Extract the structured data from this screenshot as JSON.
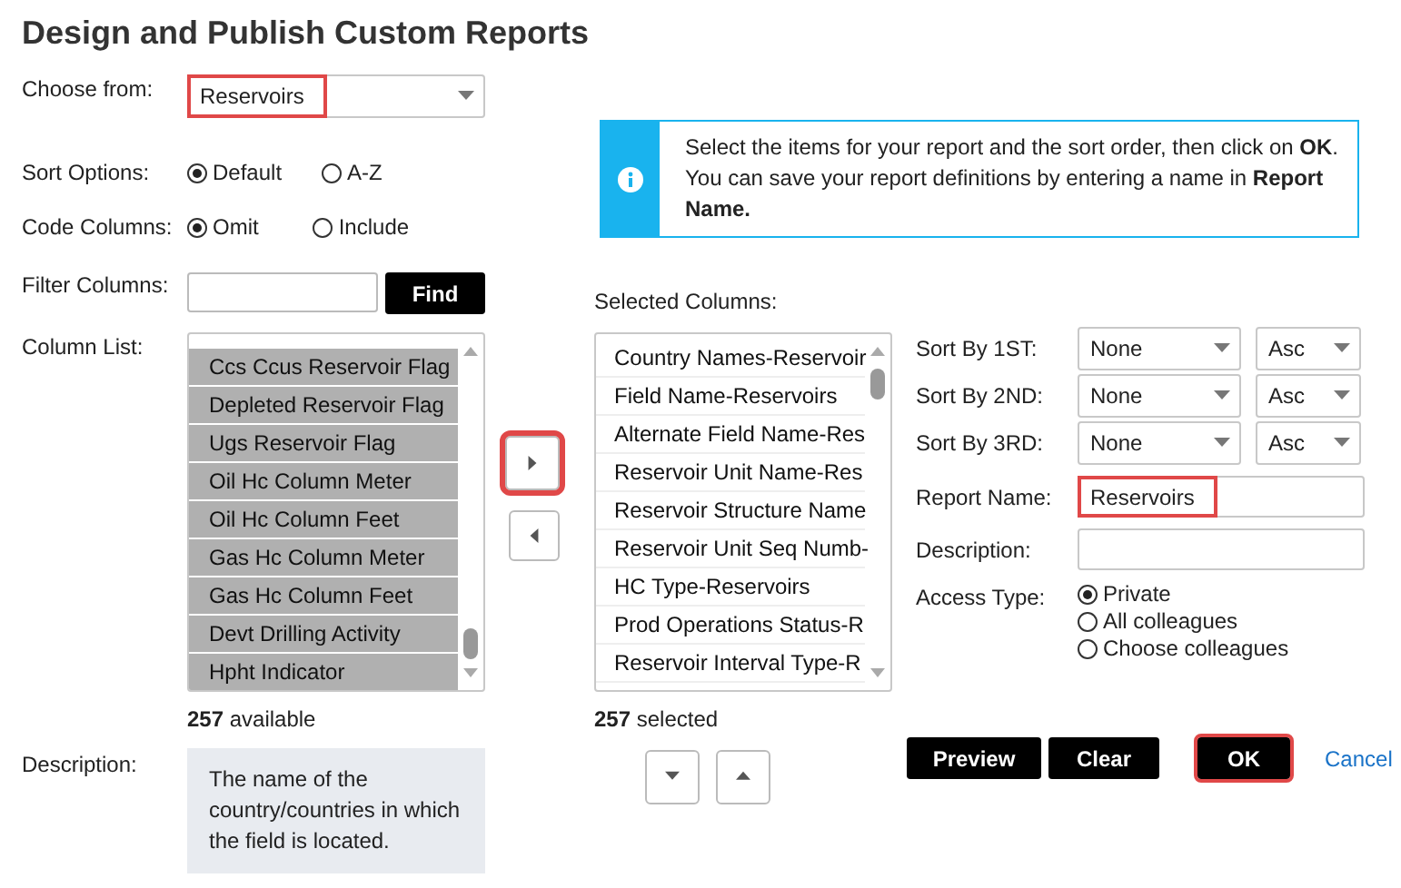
{
  "title": "Design and Publish Custom Reports",
  "choose_from": {
    "label": "Choose from:",
    "value": "Reservoirs",
    "highlighted": true
  },
  "sort_options": {
    "label": "Sort Options:",
    "options": [
      {
        "label": "Default",
        "selected": true
      },
      {
        "label": "A-Z",
        "selected": false
      }
    ]
  },
  "code_columns": {
    "label": "Code Columns:",
    "options": [
      {
        "label": "Omit",
        "selected": true
      },
      {
        "label": "Include",
        "selected": false
      }
    ]
  },
  "info": {
    "text": "Select the items for your report and the sort order, then click on **OK**. You can save your report definitions by entering a name in **Report Name.**"
  },
  "filter": {
    "label": "Filter Columns:",
    "button": "Find"
  },
  "column_list": {
    "label": "Column List:",
    "count_text": "**257** available",
    "items": [
      {
        "label": "Ccs Ccus Reservoir Flag"
      },
      {
        "label": "Depleted Reservoir Flag"
      },
      {
        "label": "Ugs Reservoir Flag"
      },
      {
        "label": "Oil Hc Column Meter"
      },
      {
        "label": "Oil Hc Column Feet"
      },
      {
        "label": "Gas Hc Column Meter"
      },
      {
        "label": "Gas Hc Column Feet"
      },
      {
        "label": "Devt Drilling Activity"
      },
      {
        "label": "Hpht Indicator"
      }
    ]
  },
  "move_buttons": [
    {
      "kind": "right",
      "highlighted": true
    },
    {
      "kind": "left",
      "highlighted": false
    }
  ],
  "selected_columns": {
    "label": "Selected Columns:",
    "count_text": "**257** selected",
    "items": [
      {
        "label": "Country Names-Reservoir"
      },
      {
        "label": "Field Name-Reservoirs"
      },
      {
        "label": "Alternate Field Name-Res"
      },
      {
        "label": "Reservoir Unit Name-Res"
      },
      {
        "label": "Reservoir Structure Name"
      },
      {
        "label": "Reservoir Unit Seq Numb-"
      },
      {
        "label": "HC Type-Reservoirs"
      },
      {
        "label": "Prod Operations Status-R"
      },
      {
        "label": "Reservoir Interval Type-R"
      }
    ]
  },
  "order_buttons": [
    {
      "kind": "down"
    },
    {
      "kind": "up"
    }
  ],
  "sort_by": [
    {
      "label": "Sort By 1ST:",
      "field": "None",
      "order": "Asc"
    },
    {
      "label": "Sort By 2ND:",
      "field": "None",
      "order": "Asc"
    },
    {
      "label": "Sort By 3RD:",
      "field": "None",
      "order": "Asc"
    }
  ],
  "report_name": {
    "label": "Report Name:",
    "value": "Reservoirs",
    "highlighted": true
  },
  "description_field": {
    "label": "Description:"
  },
  "access_type": {
    "label": "Access Type:",
    "options": [
      {
        "label": "Private",
        "selected": true
      },
      {
        "label": "All colleagues",
        "selected": false
      },
      {
        "label": "Choose colleagues",
        "selected": false
      }
    ]
  },
  "description": {
    "label": "Description:",
    "text": "The name of the country/countries in which the field is located."
  },
  "actions": [
    {
      "kind": "button",
      "label": "Preview",
      "highlighted": false
    },
    {
      "kind": "button",
      "label": "Clear",
      "highlighted": false
    },
    {
      "kind": "button",
      "label": "OK",
      "highlighted": true
    },
    {
      "kind": "link",
      "label": "Cancel",
      "highlighted": false
    }
  ]
}
